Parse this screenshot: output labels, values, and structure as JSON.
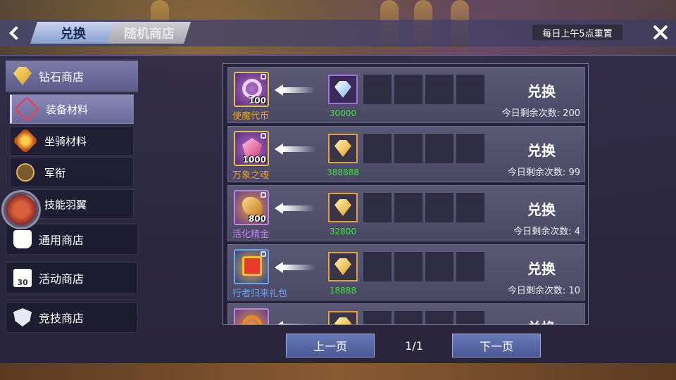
{
  "header": {
    "tabs": [
      {
        "label": "兑换",
        "active": true
      },
      {
        "label": "随机商店",
        "active": false
      }
    ],
    "reset_notice": "每日上午5点重置"
  },
  "sidebar": {
    "shops": [
      {
        "label": "钻石商店",
        "icon": "diamond-icon",
        "expanded": true
      },
      {
        "label": "通用商店",
        "icon": "bag-icon"
      },
      {
        "label": "活动商店",
        "icon": "calendar-icon"
      },
      {
        "label": "竞技商店",
        "icon": "shield-icon"
      }
    ],
    "sub_items": [
      {
        "label": "装备材料",
        "icon": "crossed-swords-icon",
        "selected": true
      },
      {
        "label": "坐骑材料",
        "icon": "fire-icon"
      },
      {
        "label": "军衔",
        "icon": "rank-badge-icon"
      },
      {
        "label": "技能羽翼",
        "icon": "wing-icon"
      }
    ],
    "calendar_day": "30"
  },
  "exchange_list": {
    "action_label": "兑换",
    "remaining_prefix": "今日剩余次数:",
    "rows": [
      {
        "item_name": "使魔代币",
        "item_qty": "100",
        "name_color": "#e8a020",
        "frame": "gold",
        "cost": "30000",
        "cost_type": "diamond",
        "remaining": "200"
      },
      {
        "item_name": "万象之魂",
        "item_qty": "1000",
        "name_color": "#e8a020",
        "frame": "gold",
        "cost": "388888",
        "cost_type": "gold",
        "remaining": "99"
      },
      {
        "item_name": "活化精金",
        "item_qty": "800",
        "name_color": "#c080f0",
        "frame": "purple",
        "cost": "32800",
        "cost_type": "gold",
        "remaining": "4"
      },
      {
        "item_name": "行者归来礼包",
        "item_qty": "",
        "name_color": "#60a8f0",
        "frame": "blue",
        "cost": "18888",
        "cost_type": "gold",
        "remaining": "10"
      },
      {
        "item_name": "",
        "item_qty": "",
        "name_color": "#e8a020",
        "frame": "purple",
        "cost": "",
        "cost_type": "gold",
        "remaining": ""
      }
    ]
  },
  "pager": {
    "prev_label": "上一页",
    "next_label": "下一页",
    "page_info": "1/1"
  }
}
